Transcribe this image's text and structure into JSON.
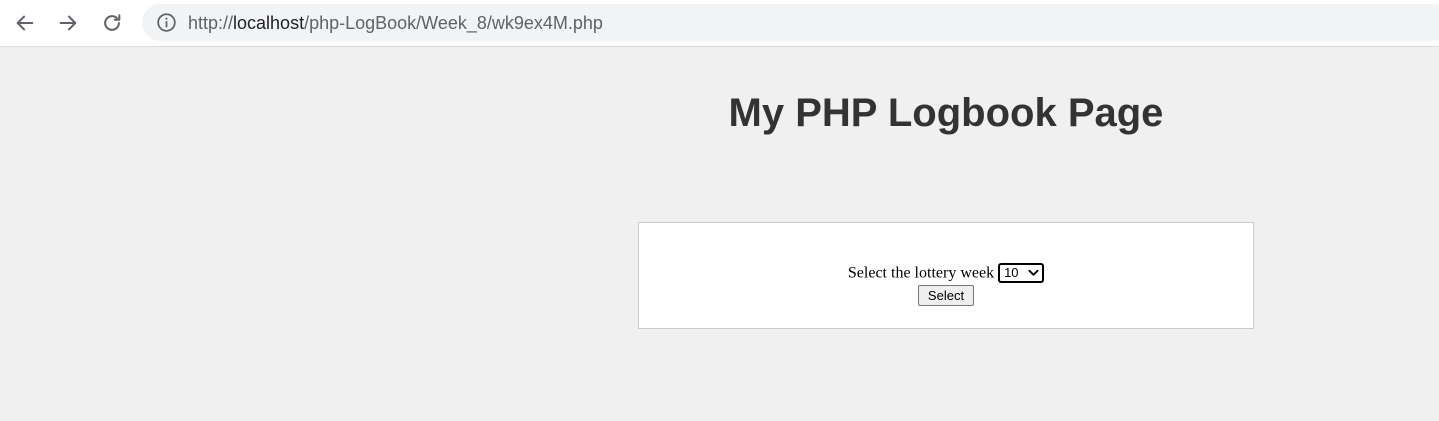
{
  "browser": {
    "url_prefix": "http://",
    "url_host": "localhost",
    "url_path": "/php-LogBook/Week_8/wk9ex4M.php"
  },
  "page": {
    "title": "My PHP Logbook Page"
  },
  "form": {
    "label": "Select the lottery week",
    "selected_week": "10",
    "submit_label": "Select"
  },
  "icons": {
    "back": "arrow-left-icon",
    "forward": "arrow-right-icon",
    "reload": "reload-icon",
    "site_info": "info-icon",
    "dropdown": "chevron-down-icon"
  },
  "colors": {
    "page_background": "#f0f0f0",
    "toolbar_background": "#ffffff",
    "omnibox_background": "#f1f3f4",
    "title_text": "#333333",
    "panel_background": "#ffffff",
    "panel_border": "#cccccc"
  }
}
